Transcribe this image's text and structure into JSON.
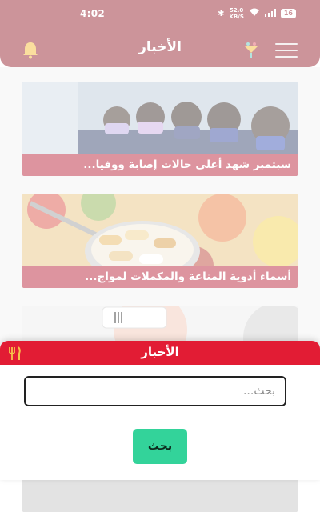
{
  "status_bar": {
    "time": "4:02",
    "speed_value": "52.0",
    "speed_unit": "KB/S",
    "battery": "16"
  },
  "header": {
    "title": "الأخبار",
    "icons": [
      "bell-icon",
      "logo-icon",
      "menu-icon"
    ]
  },
  "news": [
    {
      "title": "سبتمبر شهد أعلى حالات إصابة ووفيا..."
    },
    {
      "title": "أسماء أدوية المناعة والمكملات لمواج..."
    }
  ],
  "search_panel": {
    "title": "الأخبار",
    "placeholder": "بحث...",
    "button_label": "بحث"
  },
  "colors": {
    "header": "#8e1220",
    "caption": "#b3132a",
    "panel_header": "#e21c34",
    "button": "#33d39a"
  }
}
